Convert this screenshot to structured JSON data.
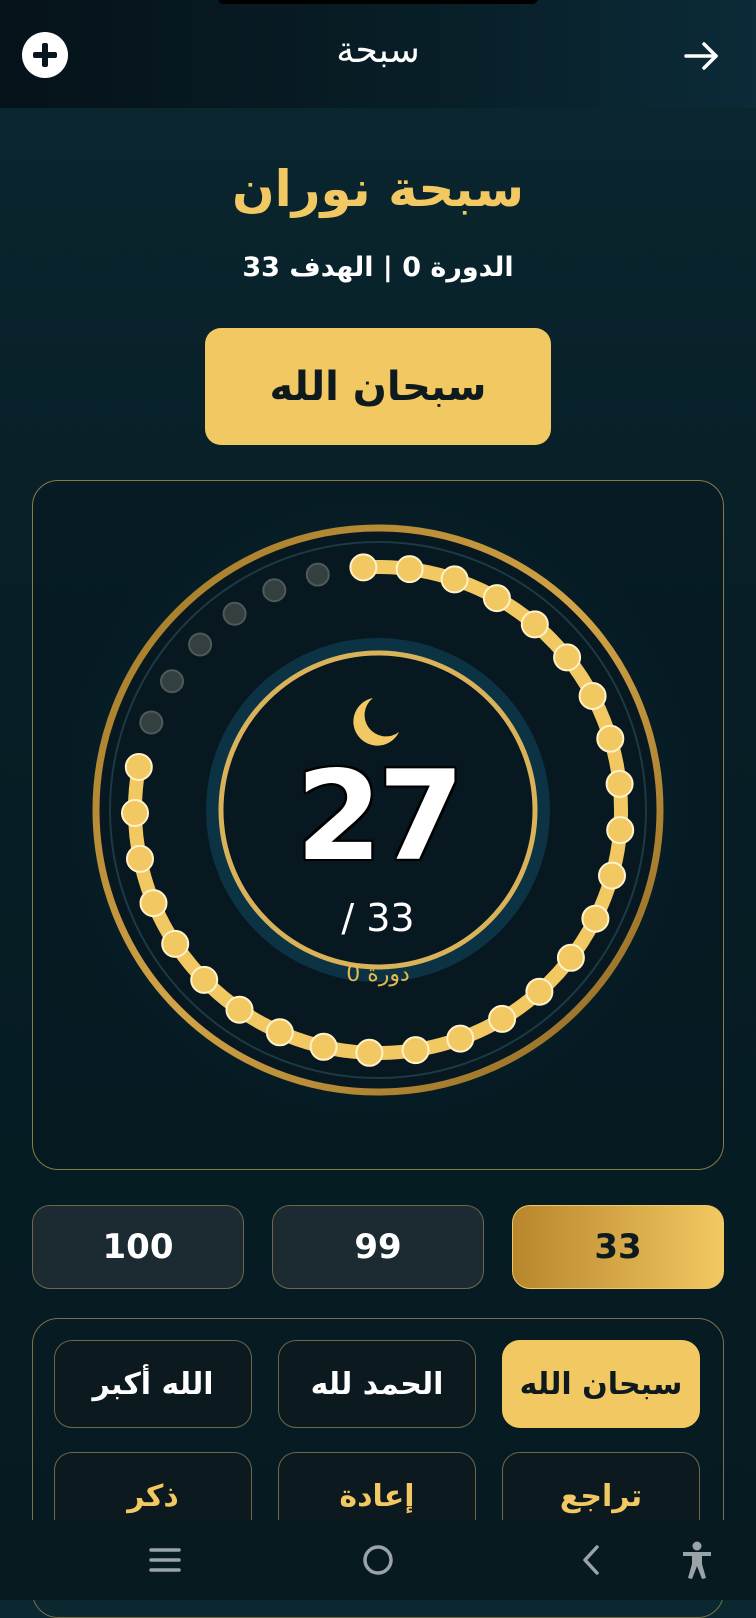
{
  "appbar": {
    "title": "سبحة",
    "add_icon": "plus-circle-icon",
    "back_icon": "arrow-right-icon"
  },
  "tasbih": {
    "name": "سبحة نوران",
    "round_info": "الدورة 0 | الهدف 33",
    "current_dhikr": "سبحان الله"
  },
  "counter": {
    "count": "27",
    "target": "/ 33",
    "round_label": "دورة 0",
    "progress": {
      "filled": 27,
      "total": 33
    },
    "icon": "crescent-moon-icon"
  },
  "targets": [
    {
      "label": "100",
      "active": false
    },
    {
      "label": "99",
      "active": false
    },
    {
      "label": "33",
      "active": true
    }
  ],
  "dhikr_options": [
    {
      "label": "الله أكبر",
      "active": false
    },
    {
      "label": "الحمد لله",
      "active": false
    },
    {
      "label": "سبحان الله",
      "active": true
    }
  ],
  "actions": [
    {
      "label": "ذكر"
    },
    {
      "label": "إعادة"
    },
    {
      "label": "تراجع"
    }
  ],
  "system_nav": {
    "items": [
      "menu-icon",
      "home-icon",
      "back-icon",
      "accessibility-icon"
    ]
  },
  "colors": {
    "gold": "#f2c862",
    "gold_dark": "#b8862c",
    "background": "#071e26",
    "bead_empty": "#33403f"
  }
}
